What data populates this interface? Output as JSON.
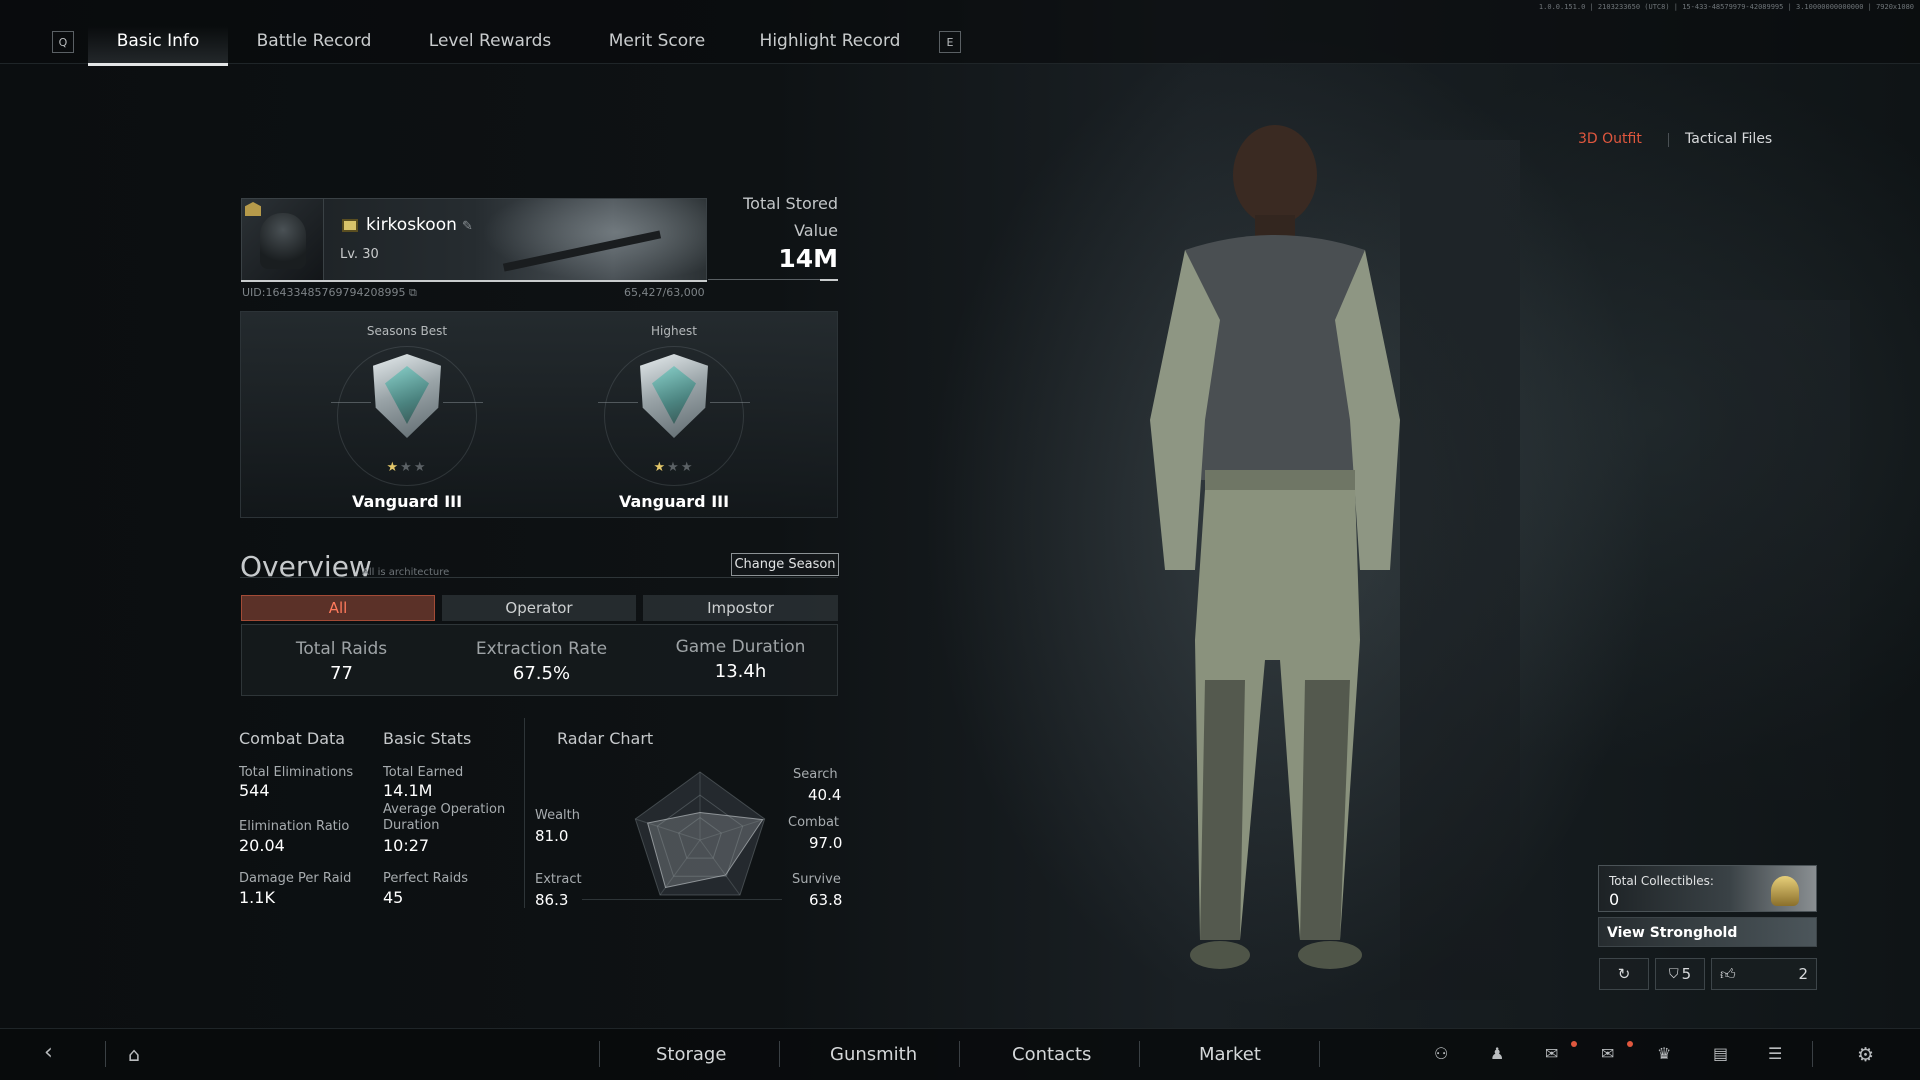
{
  "topbar": {
    "key_left": "Q",
    "key_right": "E",
    "tabs": [
      {
        "label": "Basic Info",
        "active": true
      },
      {
        "label": "Battle Record",
        "active": false
      },
      {
        "label": "Level Rewards",
        "active": false
      },
      {
        "label": "Merit Score",
        "active": false
      },
      {
        "label": "Highlight Record",
        "active": false
      }
    ],
    "version": "1.0.0.151.0 | 2103233650 (UTC8) | 15-433-48579979-42089995 | 3.10000000000000 | 7920x1080"
  },
  "right_links": {
    "outfit": "3D Outfit",
    "tactical": "Tactical Files",
    "outfit_color": "#e0573e"
  },
  "profile": {
    "name": "kirkoskoon",
    "level": "Lv. 30",
    "uid": "UID:16433485769794208995",
    "xp": "65,427/63,000",
    "xp_progress": 1.0,
    "total_stored_label": "Total Stored Value",
    "total_stored_value": "14M"
  },
  "ranks": [
    {
      "label": "Seasons Best",
      "name": "Vanguard III",
      "stars": 1,
      "stars_max": 3
    },
    {
      "label": "Highest",
      "name": "Vanguard III",
      "stars": 1,
      "stars_max": 3
    }
  ],
  "overview": {
    "title": "Overview",
    "subtitle": "All is architecture",
    "change_season": "Change Season",
    "filters": [
      {
        "label": "All",
        "active": true
      },
      {
        "label": "Operator",
        "active": false
      },
      {
        "label": "Impostor",
        "active": false
      }
    ],
    "stats": [
      {
        "label": "Total Raids",
        "value": "77"
      },
      {
        "label": "Extraction Rate",
        "value": "67.5%"
      },
      {
        "label": "Game Duration",
        "value": "13.4h"
      }
    ],
    "accent_color": "#ff7a5c"
  },
  "combat": {
    "title": "Combat Data",
    "items": [
      {
        "label": "Total Eliminations",
        "value": "544"
      },
      {
        "label": "Elimination Ratio",
        "value": "20.04"
      },
      {
        "label": "Damage Per Raid",
        "value": "1.1K"
      }
    ]
  },
  "basic": {
    "title": "Basic Stats",
    "items": [
      {
        "label": "Total Earned",
        "value": "14.1M"
      },
      {
        "label": "Average Operation Duration",
        "value": "10:27"
      },
      {
        "label": "Perfect Raids",
        "value": "45"
      }
    ]
  },
  "radar": {
    "title": "Radar Chart",
    "axes": [
      {
        "label": "Search",
        "value": "40.4",
        "score": 40.4
      },
      {
        "label": "Combat",
        "value": "97.0",
        "score": 97.0
      },
      {
        "label": "Survive",
        "value": "63.8",
        "score": 63.8
      },
      {
        "label": "Extract",
        "value": "86.3",
        "score": 86.3
      },
      {
        "label": "Wealth",
        "value": "81.0",
        "score": 81.0
      }
    ]
  },
  "collectibles": {
    "label": "Total Collectibles:",
    "value": "0",
    "stronghold": "View Stronghold",
    "badge_count": "5",
    "likes": "2"
  },
  "bottom": {
    "nav": [
      "Storage",
      "Gunsmith",
      "Contacts",
      "Market"
    ],
    "icons": [
      "friends-search-icon",
      "profile-icon",
      "chat-icon",
      "mail-icon",
      "trophy-icon",
      "notes-icon",
      "tasks-icon",
      "settings-icon"
    ]
  }
}
